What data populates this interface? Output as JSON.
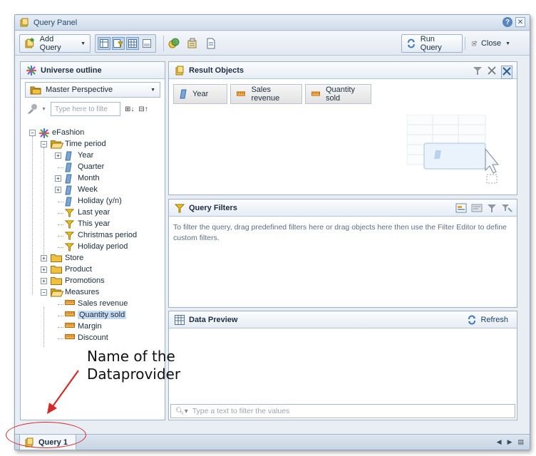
{
  "window": {
    "title": "Query Panel"
  },
  "toolbar": {
    "add_query": "Add Query",
    "run_query": "Run Query",
    "close": "Close"
  },
  "universe": {
    "title": "Universe outline",
    "perspective": "Master Perspective",
    "search_placeholder": "Type here to filte",
    "tree": [
      {
        "label": "eFashion",
        "level": 0,
        "kind": "universe",
        "exp": "-"
      },
      {
        "label": "Time period",
        "level": 1,
        "kind": "folder-open",
        "exp": "-"
      },
      {
        "label": "Year",
        "level": 2,
        "kind": "dim",
        "exp": "+"
      },
      {
        "label": "Quarter",
        "level": 2,
        "kind": "dim",
        "exp": ""
      },
      {
        "label": "Month",
        "level": 2,
        "kind": "dim",
        "exp": "+"
      },
      {
        "label": "Week",
        "level": 2,
        "kind": "dim",
        "exp": "+"
      },
      {
        "label": "Holiday (y/n)",
        "level": 2,
        "kind": "dim",
        "exp": ""
      },
      {
        "label": "Last year",
        "level": 2,
        "kind": "filter",
        "exp": ""
      },
      {
        "label": "This year",
        "level": 2,
        "kind": "filter",
        "exp": ""
      },
      {
        "label": "Christmas period",
        "level": 2,
        "kind": "filter",
        "exp": ""
      },
      {
        "label": "Holiday period",
        "level": 2,
        "kind": "filter",
        "exp": ""
      },
      {
        "label": "Store",
        "level": 1,
        "kind": "folder",
        "exp": "+"
      },
      {
        "label": "Product",
        "level": 1,
        "kind": "folder",
        "exp": "+"
      },
      {
        "label": "Promotions",
        "level": 1,
        "kind": "folder",
        "exp": "+"
      },
      {
        "label": "Measures",
        "level": 1,
        "kind": "folder-open",
        "exp": "-"
      },
      {
        "label": "Sales revenue",
        "level": 2,
        "kind": "measure",
        "exp": ""
      },
      {
        "label": "Quantity sold",
        "level": 2,
        "kind": "measure",
        "exp": "",
        "selected": true
      },
      {
        "label": "Margin",
        "level": 2,
        "kind": "measure",
        "exp": ""
      },
      {
        "label": "Discount",
        "level": 2,
        "kind": "measure",
        "exp": ""
      }
    ]
  },
  "result_objects": {
    "title": "Result Objects",
    "items": [
      {
        "label": "Year",
        "kind": "dim"
      },
      {
        "label": "Sales revenue",
        "kind": "measure"
      },
      {
        "label": "Quantity sold",
        "kind": "measure"
      }
    ]
  },
  "query_filters": {
    "title": "Query Filters",
    "hint": "To filter the query, drag predefined filters here or drag objects here then use the Filter Editor to define custom filters."
  },
  "data_preview": {
    "title": "Data Preview",
    "refresh": "Refresh",
    "filter_placeholder": "Type a text to filter the values"
  },
  "tabs": {
    "query_tab": "Query 1"
  },
  "annotation": {
    "line1": "Name of the",
    "line2": "Dataprovider"
  },
  "colors": {
    "annotation_red": "#d42a2a",
    "selection": "#c7dcf2"
  }
}
